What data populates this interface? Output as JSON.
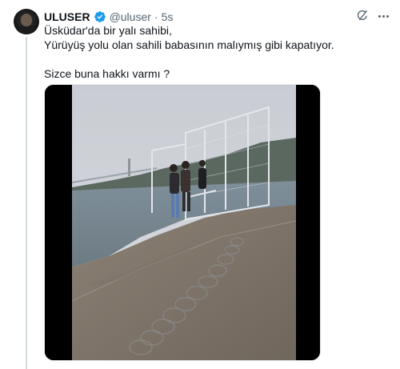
{
  "tweet": {
    "display_name": "ULUSER",
    "handle": "@uluser",
    "separator": "·",
    "time": "5s",
    "text_line_1": "Üsküdar'da bir yalı sahibi,",
    "text_line_2": "Yürüyüş yolu olan sahili babasının malıymış gibi kapatıyor.",
    "text_line_3": "Sizce buna hakkı varmı ?"
  },
  "icons": {
    "verified": "verified-badge-icon",
    "grok": "grok-icon",
    "more": "more-options-icon"
  },
  "colors": {
    "accent": "#1d9bf0",
    "secondary_text": "#536471",
    "thread_line": "#cfd9de"
  }
}
